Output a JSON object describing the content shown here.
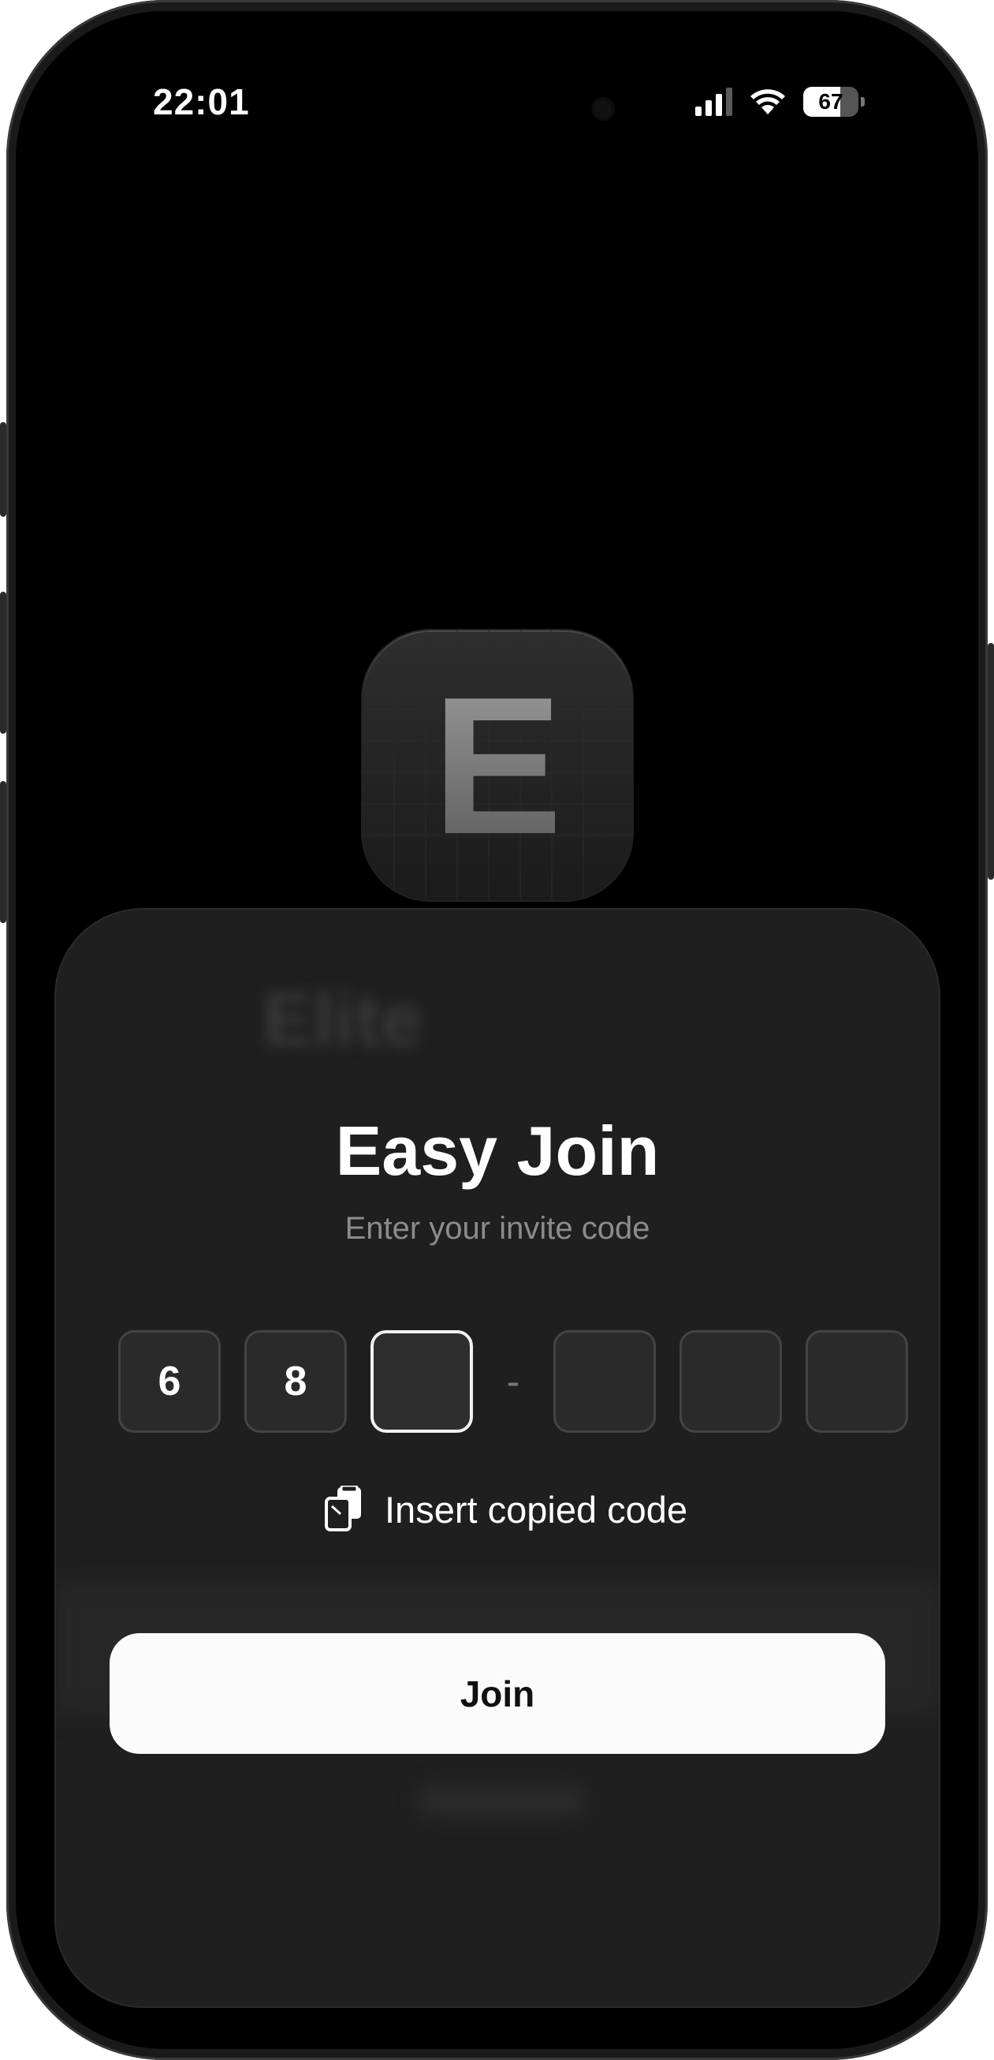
{
  "status_bar": {
    "time": "22:01",
    "battery_percent": "67",
    "battery_level": 0.67,
    "signal_bars_filled": 3,
    "icons": [
      "signal-icon",
      "wifi-icon",
      "battery-icon"
    ]
  },
  "app_icon": {
    "letter": "E"
  },
  "background_text": {
    "blurred_title": "Elite"
  },
  "sheet": {
    "title": "Easy Join",
    "subtitle": "Enter your invite code",
    "code_digits": [
      "6",
      "8",
      "",
      "",
      "",
      ""
    ],
    "separator": "-",
    "active_index": 2,
    "paste_label": "Insert copied code",
    "paste_icon": "clipboard-icon",
    "join_label": "Join"
  },
  "colors": {
    "background": "#000000",
    "sheet": "#1f1f1f",
    "code_box": "#2a2a2a",
    "join_button": "#fbfbfb"
  }
}
